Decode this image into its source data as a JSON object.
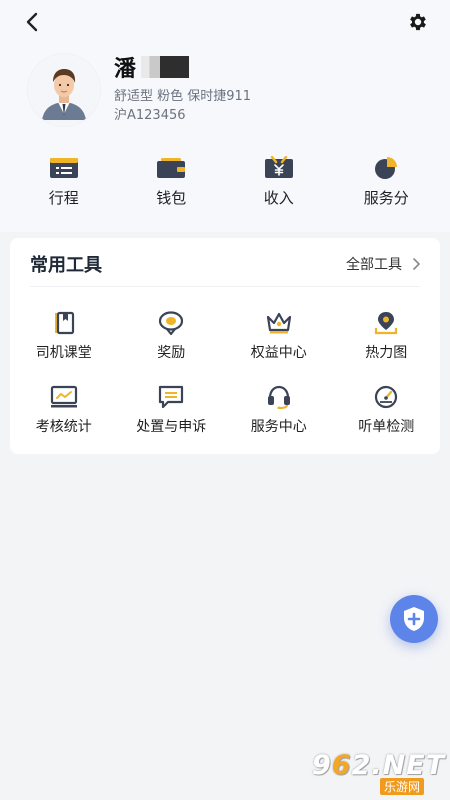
{
  "profile": {
    "name": "潘",
    "car_info": "舒适型 粉色 保时捷911",
    "plate": "沪A123456"
  },
  "quick_actions": [
    {
      "label": "行程",
      "icon": "trip-list-icon"
    },
    {
      "label": "钱包",
      "icon": "wallet-icon"
    },
    {
      "label": "收入",
      "icon": "income-yen-icon"
    },
    {
      "label": "服务分",
      "icon": "score-pie-icon"
    }
  ],
  "tools": {
    "title": "常用工具",
    "all_label": "全部工具",
    "items": [
      {
        "label": "司机课堂",
        "icon": "book-icon"
      },
      {
        "label": "奖励",
        "icon": "reward-badge-icon"
      },
      {
        "label": "权益中心",
        "icon": "crown-icon"
      },
      {
        "label": "热力图",
        "icon": "location-pin-icon"
      },
      {
        "label": "考核统计",
        "icon": "chart-board-icon"
      },
      {
        "label": "处置与申诉",
        "icon": "message-icon"
      },
      {
        "label": "服务中心",
        "icon": "headset-icon"
      },
      {
        "label": "听单检测",
        "icon": "gauge-icon"
      }
    ]
  },
  "colors": {
    "accent": "#f0b429",
    "icon_dark": "#3b4356",
    "fab": "#5d84e8"
  },
  "watermark": {
    "brand_a": "9",
    "brand_b": "6",
    "brand_c": "2",
    "brand_d": ".NET",
    "sub": "乐游网"
  }
}
